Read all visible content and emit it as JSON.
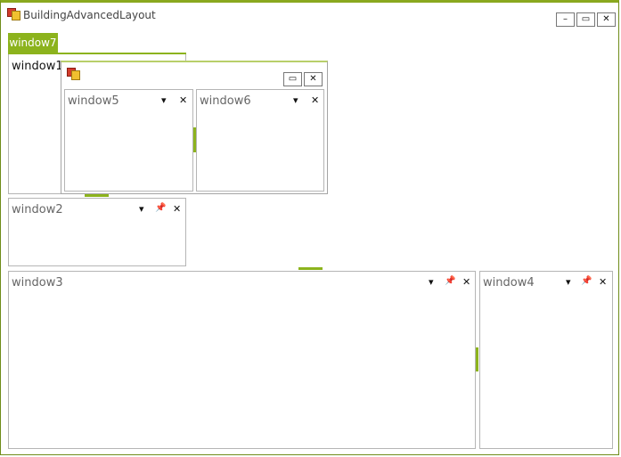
{
  "window": {
    "title": "BuildingAdvancedLayout",
    "minimize_glyph": "–",
    "maximize_glyph": "▭",
    "close_glyph": "✕"
  },
  "tabs": [
    {
      "label": "window7",
      "selected": true
    }
  ],
  "panes": {
    "window1": {
      "title": "window1"
    },
    "window2": {
      "title": "window2",
      "menu_glyph": "▾",
      "pin_glyph": "📌",
      "close_glyph": "✕"
    },
    "window3": {
      "title": "window3",
      "menu_glyph": "▾",
      "pin_glyph": "📌",
      "close_glyph": "✕"
    },
    "window4": {
      "title": "window4",
      "menu_glyph": "▾",
      "pin_glyph": "📌",
      "close_glyph": "✕"
    }
  },
  "floating": {
    "maximize_glyph": "▭",
    "close_glyph": "✕",
    "window5": {
      "title": "window5",
      "menu_glyph": "▾",
      "close_glyph": "✕"
    },
    "window6": {
      "title": "window6",
      "menu_glyph": "▾",
      "close_glyph": "✕"
    }
  },
  "colors": {
    "accent": "#8cb31d",
    "frame": "#6f8c1a",
    "pane_border": "#b5b5b5"
  },
  "icons": [
    "app-icon",
    "minimize-icon",
    "maximize-icon",
    "close-icon",
    "dropdown-icon",
    "pin-icon"
  ]
}
